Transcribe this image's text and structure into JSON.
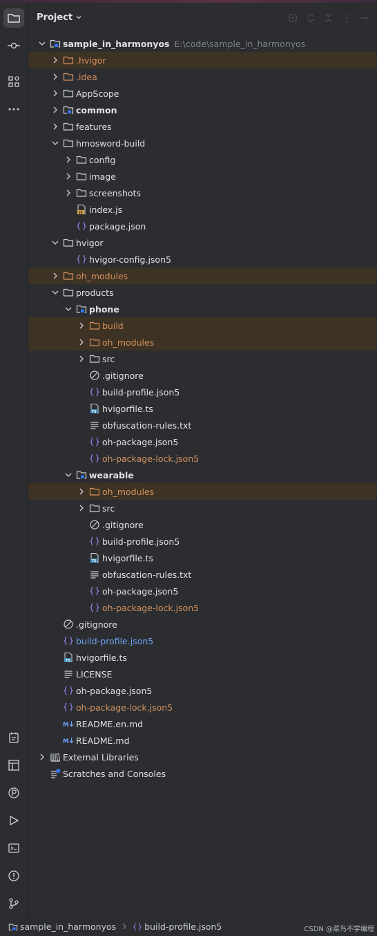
{
  "panel": {
    "title": "Project"
  },
  "tree": [
    {
      "depth": 0,
      "expanded": true,
      "icon": "module-folder-icon",
      "label": "sample_in_harmonyos",
      "path": "E:\\code\\sample_in_harmonyos",
      "style": "bold"
    },
    {
      "depth": 1,
      "expanded": false,
      "icon": "folder-icon",
      "label": ".hvigor",
      "style": "orange",
      "hl": true
    },
    {
      "depth": 1,
      "expanded": false,
      "icon": "folder-icon",
      "label": ".idea",
      "style": "orange"
    },
    {
      "depth": 1,
      "expanded": false,
      "icon": "folder-icon",
      "label": "AppScope"
    },
    {
      "depth": 1,
      "expanded": false,
      "icon": "module-folder-icon",
      "label": "common",
      "style": "bold"
    },
    {
      "depth": 1,
      "expanded": false,
      "icon": "folder-icon",
      "label": "features"
    },
    {
      "depth": 1,
      "expanded": true,
      "icon": "folder-icon",
      "label": "hmosword-build"
    },
    {
      "depth": 2,
      "expanded": false,
      "icon": "folder-icon",
      "label": "config"
    },
    {
      "depth": 2,
      "expanded": false,
      "icon": "folder-icon",
      "label": "image"
    },
    {
      "depth": 2,
      "expanded": false,
      "icon": "folder-icon",
      "label": "screenshots"
    },
    {
      "depth": 2,
      "icon": "js-file-icon",
      "label": "index.js"
    },
    {
      "depth": 2,
      "icon": "json-file-icon",
      "label": "package.json"
    },
    {
      "depth": 1,
      "expanded": true,
      "icon": "folder-icon",
      "label": "hvigor"
    },
    {
      "depth": 2,
      "icon": "json-file-icon",
      "label": "hvigor-config.json5"
    },
    {
      "depth": 1,
      "expanded": false,
      "icon": "folder-icon",
      "label": "oh_modules",
      "style": "orange",
      "hl": true
    },
    {
      "depth": 1,
      "expanded": true,
      "icon": "folder-icon",
      "label": "products"
    },
    {
      "depth": 2,
      "expanded": true,
      "icon": "module-folder-icon",
      "label": "phone",
      "style": "bold"
    },
    {
      "depth": 3,
      "expanded": false,
      "icon": "folder-icon",
      "label": "build",
      "style": "orange",
      "hl": true
    },
    {
      "depth": 3,
      "expanded": false,
      "icon": "folder-icon",
      "label": "oh_modules",
      "style": "orange",
      "hl": true
    },
    {
      "depth": 3,
      "expanded": false,
      "icon": "folder-icon",
      "label": "src"
    },
    {
      "depth": 3,
      "icon": "gitignore-icon",
      "label": ".gitignore"
    },
    {
      "depth": 3,
      "icon": "json-file-icon",
      "label": "build-profile.json5"
    },
    {
      "depth": 3,
      "icon": "ts-file-icon",
      "label": "hvigorfile.ts"
    },
    {
      "depth": 3,
      "icon": "text-file-icon",
      "label": "obfuscation-rules.txt"
    },
    {
      "depth": 3,
      "icon": "json-file-icon",
      "label": "oh-package.json5"
    },
    {
      "depth": 3,
      "icon": "json-file-icon",
      "label": "oh-package-lock.json5",
      "style": "orange"
    },
    {
      "depth": 2,
      "expanded": true,
      "icon": "module-folder-icon",
      "label": "wearable",
      "style": "bold"
    },
    {
      "depth": 3,
      "expanded": false,
      "icon": "folder-icon",
      "label": "oh_modules",
      "style": "orange",
      "hl": true
    },
    {
      "depth": 3,
      "expanded": false,
      "icon": "folder-icon",
      "label": "src"
    },
    {
      "depth": 3,
      "icon": "gitignore-icon",
      "label": ".gitignore"
    },
    {
      "depth": 3,
      "icon": "json-file-icon",
      "label": "build-profile.json5"
    },
    {
      "depth": 3,
      "icon": "ts-file-icon",
      "label": "hvigorfile.ts"
    },
    {
      "depth": 3,
      "icon": "text-file-icon",
      "label": "obfuscation-rules.txt"
    },
    {
      "depth": 3,
      "icon": "json-file-icon",
      "label": "oh-package.json5"
    },
    {
      "depth": 3,
      "icon": "json-file-icon",
      "label": "oh-package-lock.json5",
      "style": "orange"
    },
    {
      "depth": 1,
      "icon": "gitignore-icon",
      "label": ".gitignore"
    },
    {
      "depth": 1,
      "icon": "json-file-icon",
      "label": "build-profile.json5",
      "style": "blue"
    },
    {
      "depth": 1,
      "icon": "ts-file-icon",
      "label": "hvigorfile.ts"
    },
    {
      "depth": 1,
      "icon": "text-file-icon",
      "label": "LICENSE"
    },
    {
      "depth": 1,
      "icon": "json-file-icon",
      "label": "oh-package.json5"
    },
    {
      "depth": 1,
      "icon": "json-file-icon",
      "label": "oh-package-lock.json5",
      "style": "orange"
    },
    {
      "depth": 1,
      "icon": "markdown-file-icon",
      "label": "README.en.md"
    },
    {
      "depth": 1,
      "icon": "markdown-file-icon",
      "label": "README.md"
    },
    {
      "depth": 0,
      "expanded": false,
      "icon": "library-icon",
      "label": "External Libraries"
    },
    {
      "depth": 0,
      "icon": "scratches-icon",
      "label": "Scratches and Consoles"
    }
  ],
  "statusbar": {
    "crumbs": [
      {
        "icon": "module-folder-icon",
        "label": "sample_in_harmonyos"
      },
      {
        "icon": "json-file-icon",
        "label": "build-profile.json5"
      }
    ],
    "watermark": "CSDN @菜鸟不学编程"
  }
}
